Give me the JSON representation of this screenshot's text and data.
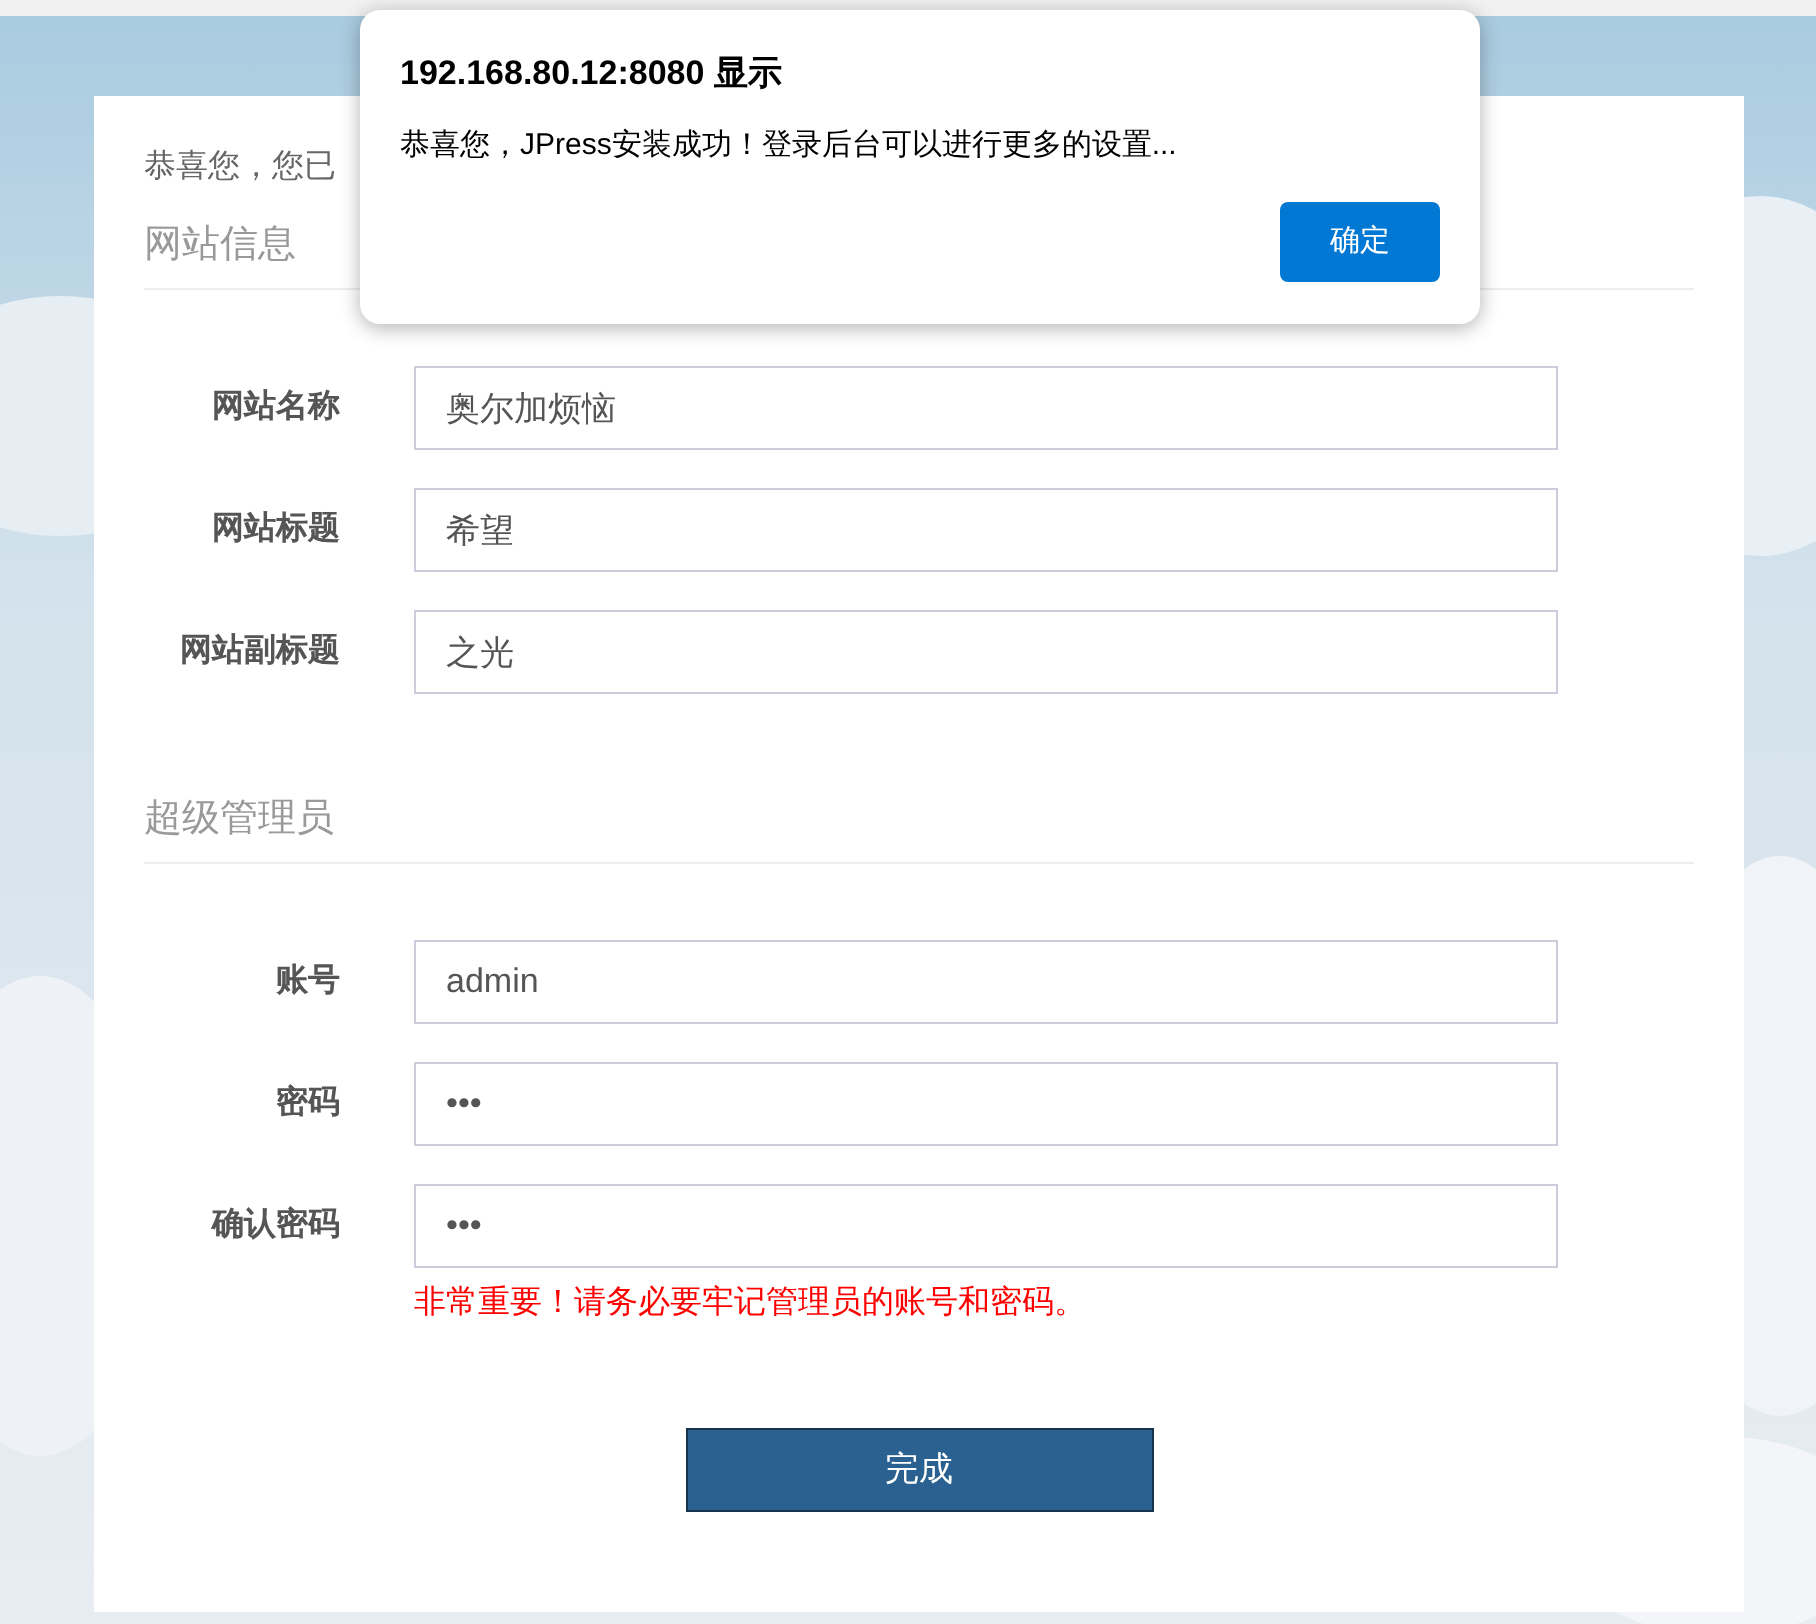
{
  "intro": "恭喜您，您已",
  "sections": [
    {
      "title": "网站信息",
      "fields": [
        {
          "label": "网站名称",
          "value": "奥尔加烦恼"
        },
        {
          "label": "网站标题",
          "value": "希望"
        },
        {
          "label": "网站副标题",
          "value": "之光"
        }
      ]
    },
    {
      "title": "超级管理员",
      "fields": [
        {
          "label": "账号",
          "value": "admin"
        },
        {
          "label": "密码",
          "value": "•••"
        },
        {
          "label": "确认密码",
          "value": "•••"
        }
      ],
      "warning": "非常重要！请务必要牢记管理员的账号和密码。"
    }
  ],
  "submit": "完成",
  "dialog": {
    "title": "192.168.80.12:8080 显示",
    "message": "恭喜您，JPress安装成功！登录后台可以进行更多的设置...",
    "button": "确定"
  }
}
